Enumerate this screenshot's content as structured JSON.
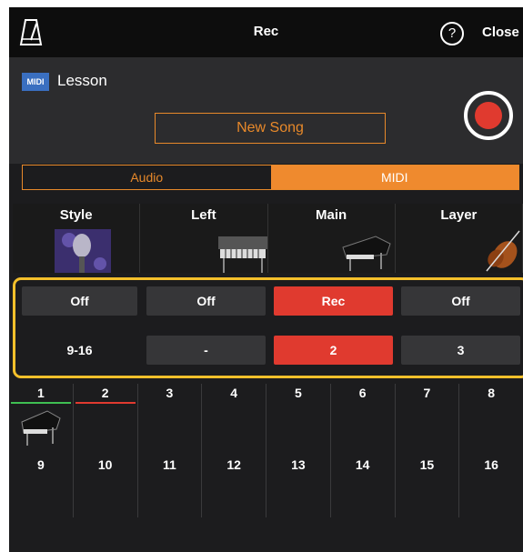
{
  "topbar": {
    "metronome_icon": "metronome-icon",
    "title": "Rec",
    "help_glyph": "?",
    "close_label": "Close"
  },
  "song": {
    "badge": "MIDI",
    "name": "Lesson",
    "new_song_label": "New Song",
    "rec_icon": "record-icon"
  },
  "mode_tabs": [
    {
      "label": "Audio",
      "selected": false
    },
    {
      "label": "MIDI",
      "selected": true
    }
  ],
  "parts": [
    {
      "label": "Style",
      "image": "microphone-image"
    },
    {
      "label": "Left",
      "image": "keyboard-image"
    },
    {
      "label": "Main",
      "image": "grand-piano-image"
    },
    {
      "label": "Layer",
      "image": "violin-image"
    }
  ],
  "rec_state": [
    "Off",
    "Off",
    "Rec",
    "Off"
  ],
  "channel_assign": {
    "style_label": "9-16",
    "values": [
      "-",
      "2",
      "3"
    ]
  },
  "channels_row1": [
    "1",
    "2",
    "3",
    "4",
    "5",
    "6",
    "7",
    "8"
  ],
  "channels_row2": [
    "9",
    "10",
    "11",
    "12",
    "13",
    "14",
    "15",
    "16"
  ],
  "colors": {
    "accent_orange": "#e8892a",
    "rec_red": "#e03a2f",
    "highlight_yellow": "#f4c02b",
    "channel1_bar": "#3fbf52",
    "channel2_bar": "#e03a2f"
  }
}
